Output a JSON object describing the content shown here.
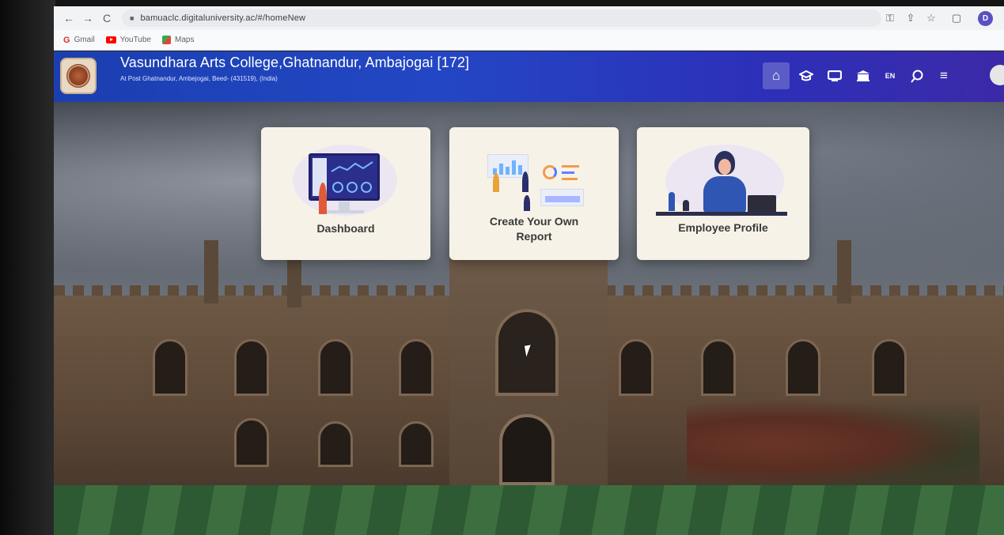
{
  "browser": {
    "url": "bamuaclc.digitaluniversity.ac/#/homeNew",
    "profile_initial": "D",
    "bookmarks": [
      {
        "label": "Gmail",
        "icon": "gmail-icon"
      },
      {
        "label": "YouTube",
        "icon": "youtube-icon"
      },
      {
        "label": "Maps",
        "icon": "maps-icon"
      }
    ],
    "gmail_glyph": "G"
  },
  "header": {
    "college_name": "Vasundhara Arts College,Ghatnandur, Ambajogai [172]",
    "address": "At Post Ghatnandur, Ambejogai, Beed- (431519), (India)",
    "lang_label": "EN",
    "accent_color": "#2347c4"
  },
  "cards": [
    {
      "label": "Dashboard"
    },
    {
      "label": "Create Your Own\nReport"
    },
    {
      "label": "Employee Profile"
    }
  ]
}
